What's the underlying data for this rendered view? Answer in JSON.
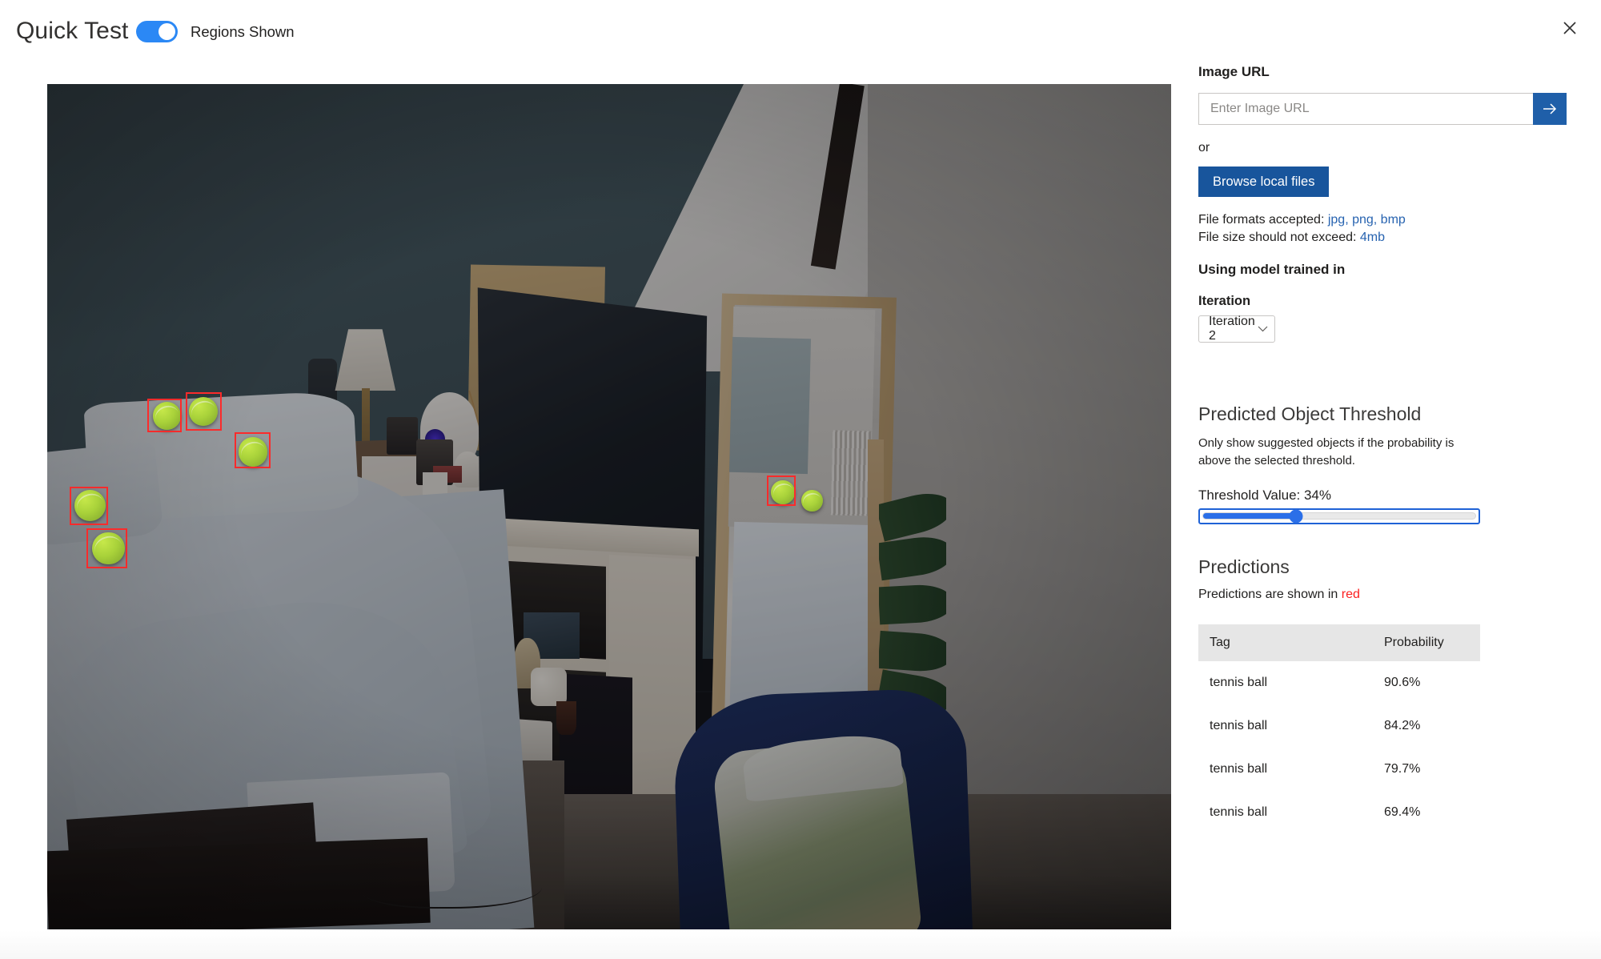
{
  "header": {
    "title": "Quick Test",
    "regions_toggle_label": "Regions Shown",
    "regions_toggle_state": "on",
    "close_icon": "close-icon"
  },
  "sidebar": {
    "image_url_label": "Image URL",
    "url_placeholder": "Enter Image URL",
    "url_value": "",
    "submit_icon": "arrow-right-icon",
    "or_text": "or",
    "browse_button": "Browse local files",
    "file_formats_prefix": "File formats accepted: ",
    "file_formats_value": "jpg, png, bmp",
    "file_size_prefix": "File size should not exceed: ",
    "file_size_value": "4mb",
    "using_model_label": "Using model trained in",
    "iteration_label": "Iteration",
    "iteration_value": "Iteration 2",
    "chevron_icon": "chevron-down-icon"
  },
  "threshold": {
    "section_title": "Predicted Object Threshold",
    "description": "Only show suggested objects if the probability is above the selected threshold.",
    "value_label": "Threshold Value: 34%",
    "percent": 34,
    "accent_color": "#2b6fe8"
  },
  "predictions": {
    "section_title": "Predictions",
    "note_prefix": "Predictions are shown in ",
    "note_color_word": "red",
    "note_color_hex": "#fc2020",
    "columns": [
      "Tag",
      "Probability"
    ],
    "rows": [
      {
        "tag": "tennis ball",
        "probability": "90.6%"
      },
      {
        "tag": "tennis ball",
        "probability": "84.2%"
      },
      {
        "tag": "tennis ball",
        "probability": "79.7%"
      },
      {
        "tag": "tennis ball",
        "probability": "69.4%"
      }
    ]
  },
  "image_viewer": {
    "alt": "bedroom-photo-with-tennis-ball-detections",
    "box_color": "#fc2b2b",
    "detections": [
      {
        "left": "8.9%",
        "top": "37.2%",
        "width": "3.1%",
        "height": "4.0%"
      },
      {
        "left": "12.3%",
        "top": "36.5%",
        "width": "3.2%",
        "height": "4.5%"
      },
      {
        "left": "16.7%",
        "top": "41.2%",
        "width": "3.2%",
        "height": "4.3%"
      },
      {
        "left": "2.0%",
        "top": "47.6%",
        "width": "3.4%",
        "height": "4.6%"
      },
      {
        "left": "3.5%",
        "top": "52.6%",
        "width": "3.6%",
        "height": "4.7%"
      },
      {
        "left": "64.0%",
        "top": "46.3%",
        "width": "2.6%",
        "height": "3.6%"
      }
    ],
    "balls": [
      {
        "left": "9.4%",
        "top": "37.6%",
        "size": "2.5%"
      },
      {
        "left": "12.6%",
        "top": "37.0%",
        "size": "2.6%"
      },
      {
        "left": "17.0%",
        "top": "41.8%",
        "size": "2.6%"
      },
      {
        "left": "2.4%",
        "top": "48.0%",
        "size": "2.8%"
      },
      {
        "left": "4.0%",
        "top": "53.0%",
        "size": "2.9%"
      },
      {
        "left": "64.4%",
        "top": "46.9%",
        "size": "2.1%"
      },
      {
        "left": "67.1%",
        "top": "48.0%",
        "size": "1.9%"
      }
    ]
  }
}
